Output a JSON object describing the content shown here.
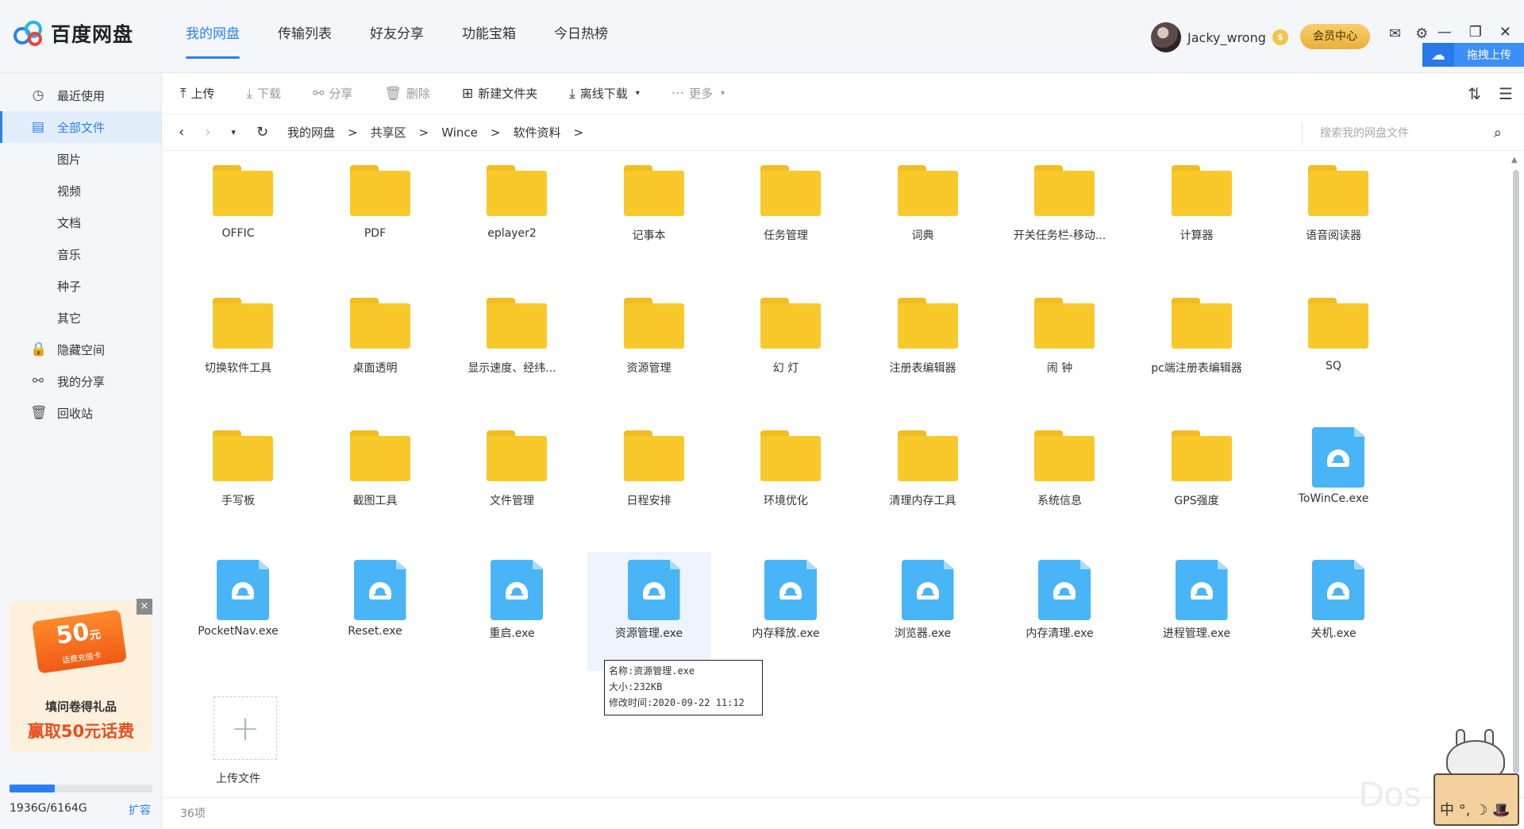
{
  "app": {
    "title": "百度网盘"
  },
  "topnav": [
    "我的网盘",
    "传输列表",
    "好友分享",
    "功能宝箱",
    "今日热榜"
  ],
  "user": {
    "name": "Jacky_wrong",
    "coin": "$",
    "vip_label": "会员中心"
  },
  "drag_upload": "拖拽上传",
  "sidebar": {
    "items": [
      {
        "icon": "clock-icon",
        "glyph": "◷",
        "label": "最近使用",
        "sub": false
      },
      {
        "icon": "file-list-icon",
        "glyph": "▤",
        "label": "全部文件",
        "sub": false,
        "active": true
      },
      {
        "label": "图片",
        "sub": true
      },
      {
        "label": "视频",
        "sub": true
      },
      {
        "label": "文档",
        "sub": true
      },
      {
        "label": "音乐",
        "sub": true
      },
      {
        "label": "种子",
        "sub": true
      },
      {
        "label": "其它",
        "sub": true
      },
      {
        "icon": "lock-icon",
        "glyph": "🔒",
        "label": "隐藏空间",
        "sub": false
      },
      {
        "icon": "share-icon",
        "glyph": "⚯",
        "label": "我的分享",
        "sub": false
      },
      {
        "icon": "trash-icon",
        "glyph": "🗑",
        "label": "回收站",
        "sub": false
      }
    ],
    "promo": {
      "amount": "50",
      "unit": "元",
      "card_caption": "话费充值卡",
      "line1": "填问卷得礼品",
      "line2": "赢取50元话费",
      "close": "×"
    },
    "quota": {
      "text": "1936G/6164G",
      "fraction": 0.314,
      "expand": "扩容"
    }
  },
  "toolbar": {
    "upload": "上传",
    "download": "下载",
    "share": "分享",
    "delete": "删除",
    "new_folder": "新建文件夹",
    "offline_download": "离线下载",
    "more": "更多"
  },
  "breadcrumb": {
    "items": [
      "我的网盘",
      "共享区",
      "Wince",
      "软件资料"
    ],
    "separator": ">"
  },
  "search": {
    "placeholder": "搜索我的网盘文件"
  },
  "files": [
    {
      "name": "OFFIC",
      "type": "folder"
    },
    {
      "name": "PDF",
      "type": "folder"
    },
    {
      "name": "eplayer2",
      "type": "folder"
    },
    {
      "name": "记事本",
      "type": "folder"
    },
    {
      "name": "任务管理",
      "type": "folder"
    },
    {
      "name": "词典",
      "type": "folder"
    },
    {
      "name": "开关任务栏-移动...",
      "type": "folder"
    },
    {
      "name": "计算器",
      "type": "folder"
    },
    {
      "name": "语音阅读器",
      "type": "folder"
    },
    {
      "name": "切换软件工具",
      "type": "folder"
    },
    {
      "name": "桌面透明",
      "type": "folder"
    },
    {
      "name": "显示速度、经纬...",
      "type": "folder"
    },
    {
      "name": "资源管理",
      "type": "folder"
    },
    {
      "name": "幻 灯",
      "type": "folder"
    },
    {
      "name": "注册表编辑器",
      "type": "folder"
    },
    {
      "name": "闹 钟",
      "type": "folder"
    },
    {
      "name": "pc端注册表编辑器",
      "type": "folder"
    },
    {
      "name": "SQ",
      "type": "folder"
    },
    {
      "name": "手写板",
      "type": "folder"
    },
    {
      "name": "截图工具",
      "type": "folder"
    },
    {
      "name": "文件管理",
      "type": "folder"
    },
    {
      "name": "日程安排",
      "type": "folder"
    },
    {
      "name": "环境优化",
      "type": "folder"
    },
    {
      "name": "清理内存工具",
      "type": "folder"
    },
    {
      "name": "系统信息",
      "type": "folder"
    },
    {
      "name": "GPS强度",
      "type": "folder"
    },
    {
      "name": "ToWinCe.exe",
      "type": "exe"
    },
    {
      "name": "PocketNav.exe",
      "type": "exe"
    },
    {
      "name": "Reset.exe",
      "type": "exe"
    },
    {
      "name": "重启.exe",
      "type": "exe"
    },
    {
      "name": "资源管理.exe",
      "type": "exe",
      "hover": true
    },
    {
      "name": "内存释放.exe",
      "type": "exe"
    },
    {
      "name": "浏览器.exe",
      "type": "exe"
    },
    {
      "name": "内存清理.exe",
      "type": "exe"
    },
    {
      "name": "进程管理.exe",
      "type": "exe"
    },
    {
      "name": "关机.exe",
      "type": "exe"
    }
  ],
  "upload_tile": {
    "label": "上传文件"
  },
  "tooltip": {
    "name": "名称:资源管理.exe",
    "size": "大小:232KB",
    "modified": "修改时间:2020-09-22 11:12"
  },
  "footer": {
    "count": "36项"
  },
  "ime": {
    "text": "中 °, ☽ 🎩"
  },
  "watermark": "Dos",
  "colors": {
    "accent": "#2b7ff4",
    "folder": "#f9c92c",
    "exe": "#49b4f6"
  }
}
